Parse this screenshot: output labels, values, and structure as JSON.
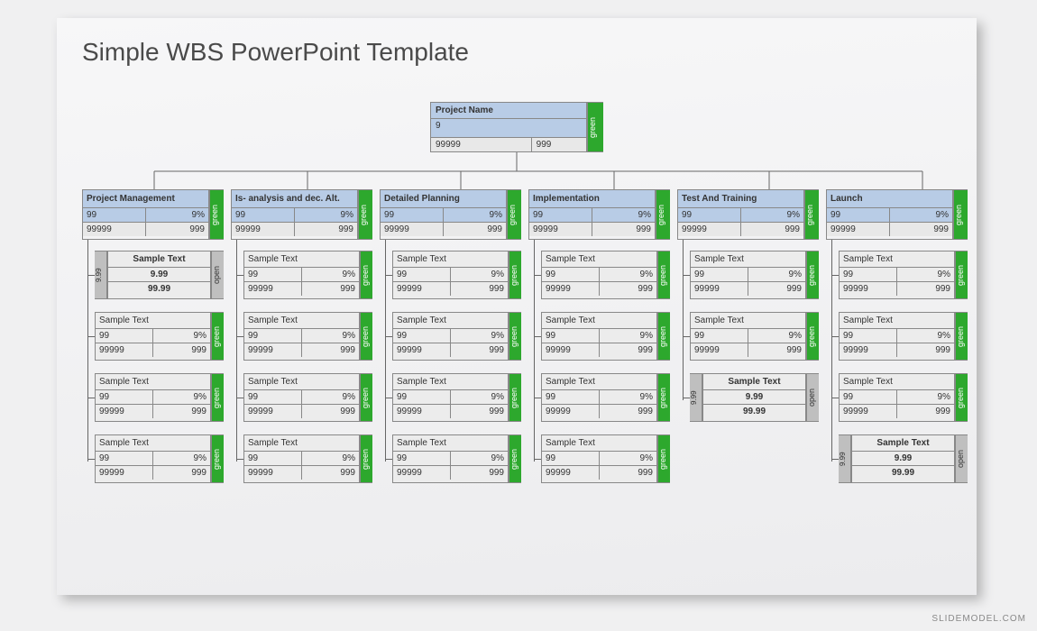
{
  "watermark": "SLIDEMODEL.COM",
  "title": "Simple WBS PowerPoint Template",
  "root": {
    "name": "Project Name",
    "v1": "9",
    "v2a": "99999",
    "v2b": "999",
    "badge": "green"
  },
  "categories": [
    {
      "name": "Project Management",
      "a": "99",
      "b": "9%",
      "c": "99999",
      "d": "999",
      "badge": "green",
      "tasks": [
        {
          "variant": "open",
          "left": "9.99",
          "title": "Sample Text",
          "r2": "9.99",
          "r3": "99.99",
          "badge": "open"
        },
        {
          "variant": "std",
          "title": "Sample Text",
          "a": "99",
          "b": "9%",
          "c": "99999",
          "d": "999",
          "badge": "green"
        },
        {
          "variant": "std",
          "title": "Sample Text",
          "a": "99",
          "b": "9%",
          "c": "99999",
          "d": "999",
          "badge": "green"
        },
        {
          "variant": "std",
          "title": "Sample Text",
          "a": "99",
          "b": "9%",
          "c": "99999",
          "d": "999",
          "badge": "green"
        }
      ]
    },
    {
      "name": "Is- analysis and dec. Alt.",
      "a": "99",
      "b": "9%",
      "c": "99999",
      "d": "999",
      "badge": "green",
      "tasks": [
        {
          "variant": "std",
          "title": "Sample Text",
          "a": "99",
          "b": "9%",
          "c": "99999",
          "d": "999",
          "badge": "green"
        },
        {
          "variant": "std",
          "title": "Sample Text",
          "a": "99",
          "b": "9%",
          "c": "99999",
          "d": "999",
          "badge": "green"
        },
        {
          "variant": "std",
          "title": "Sample Text",
          "a": "99",
          "b": "9%",
          "c": "99999",
          "d": "999",
          "badge": "green"
        },
        {
          "variant": "std",
          "title": "Sample Text",
          "a": "99",
          "b": "9%",
          "c": "99999",
          "d": "999",
          "badge": "green"
        }
      ]
    },
    {
      "name": "Detailed Planning",
      "a": "99",
      "b": "9%",
      "c": "99999",
      "d": "999",
      "badge": "green",
      "tasks": [
        {
          "variant": "std",
          "title": "Sample Text",
          "a": "99",
          "b": "9%",
          "c": "99999",
          "d": "999",
          "badge": "green"
        },
        {
          "variant": "std",
          "title": "Sample Text",
          "a": "99",
          "b": "9%",
          "c": "99999",
          "d": "999",
          "badge": "green"
        },
        {
          "variant": "std",
          "title": "Sample Text",
          "a": "99",
          "b": "9%",
          "c": "99999",
          "d": "999",
          "badge": "green"
        },
        {
          "variant": "std",
          "title": "Sample Text",
          "a": "99",
          "b": "9%",
          "c": "99999",
          "d": "999",
          "badge": "green"
        }
      ]
    },
    {
      "name": "Implementation",
      "a": "99",
      "b": "9%",
      "c": "99999",
      "d": "999",
      "badge": "green",
      "tasks": [
        {
          "variant": "std",
          "title": "Sample Text",
          "a": "99",
          "b": "9%",
          "c": "99999",
          "d": "999",
          "badge": "green"
        },
        {
          "variant": "std",
          "title": "Sample Text",
          "a": "99",
          "b": "9%",
          "c": "99999",
          "d": "999",
          "badge": "green"
        },
        {
          "variant": "std",
          "title": "Sample Text",
          "a": "99",
          "b": "9%",
          "c": "99999",
          "d": "999",
          "badge": "green"
        },
        {
          "variant": "std",
          "title": "Sample Text",
          "a": "99",
          "b": "9%",
          "c": "99999",
          "d": "999",
          "badge": "green"
        }
      ]
    },
    {
      "name": "Test And Training",
      "a": "99",
      "b": "9%",
      "c": "99999",
      "d": "999",
      "badge": "green",
      "tasks": [
        {
          "variant": "std",
          "title": "Sample Text",
          "a": "99",
          "b": "9%",
          "c": "99999",
          "d": "999",
          "badge": "green"
        },
        {
          "variant": "std",
          "title": "Sample Text",
          "a": "99",
          "b": "9%",
          "c": "99999",
          "d": "999",
          "badge": "green"
        },
        {
          "variant": "open",
          "left": "9.99",
          "title": "Sample Text",
          "r2": "9.99",
          "r3": "99.99",
          "badge": "open"
        }
      ]
    },
    {
      "name": "Launch",
      "a": "99",
      "b": "9%",
      "c": "99999",
      "d": "999",
      "badge": "green",
      "tasks": [
        {
          "variant": "std",
          "title": "Sample Text",
          "a": "99",
          "b": "9%",
          "c": "99999",
          "d": "999",
          "badge": "green"
        },
        {
          "variant": "std",
          "title": "Sample Text",
          "a": "99",
          "b": "9%",
          "c": "99999",
          "d": "999",
          "badge": "green"
        },
        {
          "variant": "std",
          "title": "Sample Text",
          "a": "99",
          "b": "9%",
          "c": "99999",
          "d": "999",
          "badge": "green"
        },
        {
          "variant": "open",
          "left": "9.99",
          "title": "Sample Text",
          "r2": "9.99",
          "r3": "99.99",
          "badge": "open"
        }
      ]
    }
  ]
}
